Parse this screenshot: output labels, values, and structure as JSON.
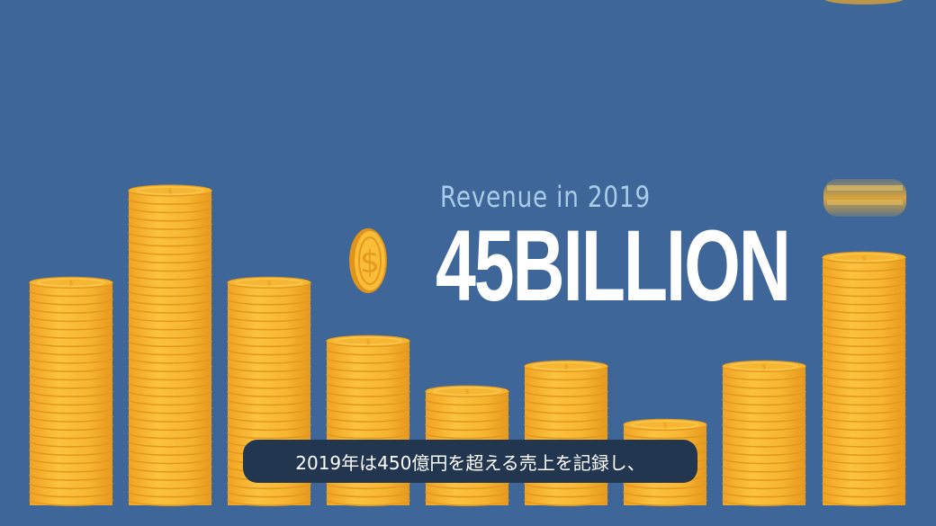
{
  "headline": {
    "subtitle": "Revenue in 2019",
    "amount": "45BILLION"
  },
  "caption": {
    "text": "2019年は450億円を超える売上を記録し、"
  },
  "colors": {
    "background": "#3e6699",
    "coin_face": "#f7b632",
    "coin_edge": "#e39a1c",
    "coin_ring": "#f9cc5a",
    "caption_bg": "#23364f",
    "subtitle": "#a8cde8",
    "amount": "#ffffff"
  },
  "coin_stacks": [
    {
      "name": "stack-1",
      "coins": 27
    },
    {
      "name": "stack-2",
      "coins": 38
    },
    {
      "name": "stack-3",
      "coins": 27
    },
    {
      "name": "stack-4",
      "coins": 20
    },
    {
      "name": "stack-5",
      "coins": 14
    },
    {
      "name": "stack-6",
      "coins": 17
    },
    {
      "name": "stack-7",
      "coins": 10
    },
    {
      "name": "stack-8",
      "coins": 17
    },
    {
      "name": "stack-9",
      "coins": 30
    }
  ]
}
